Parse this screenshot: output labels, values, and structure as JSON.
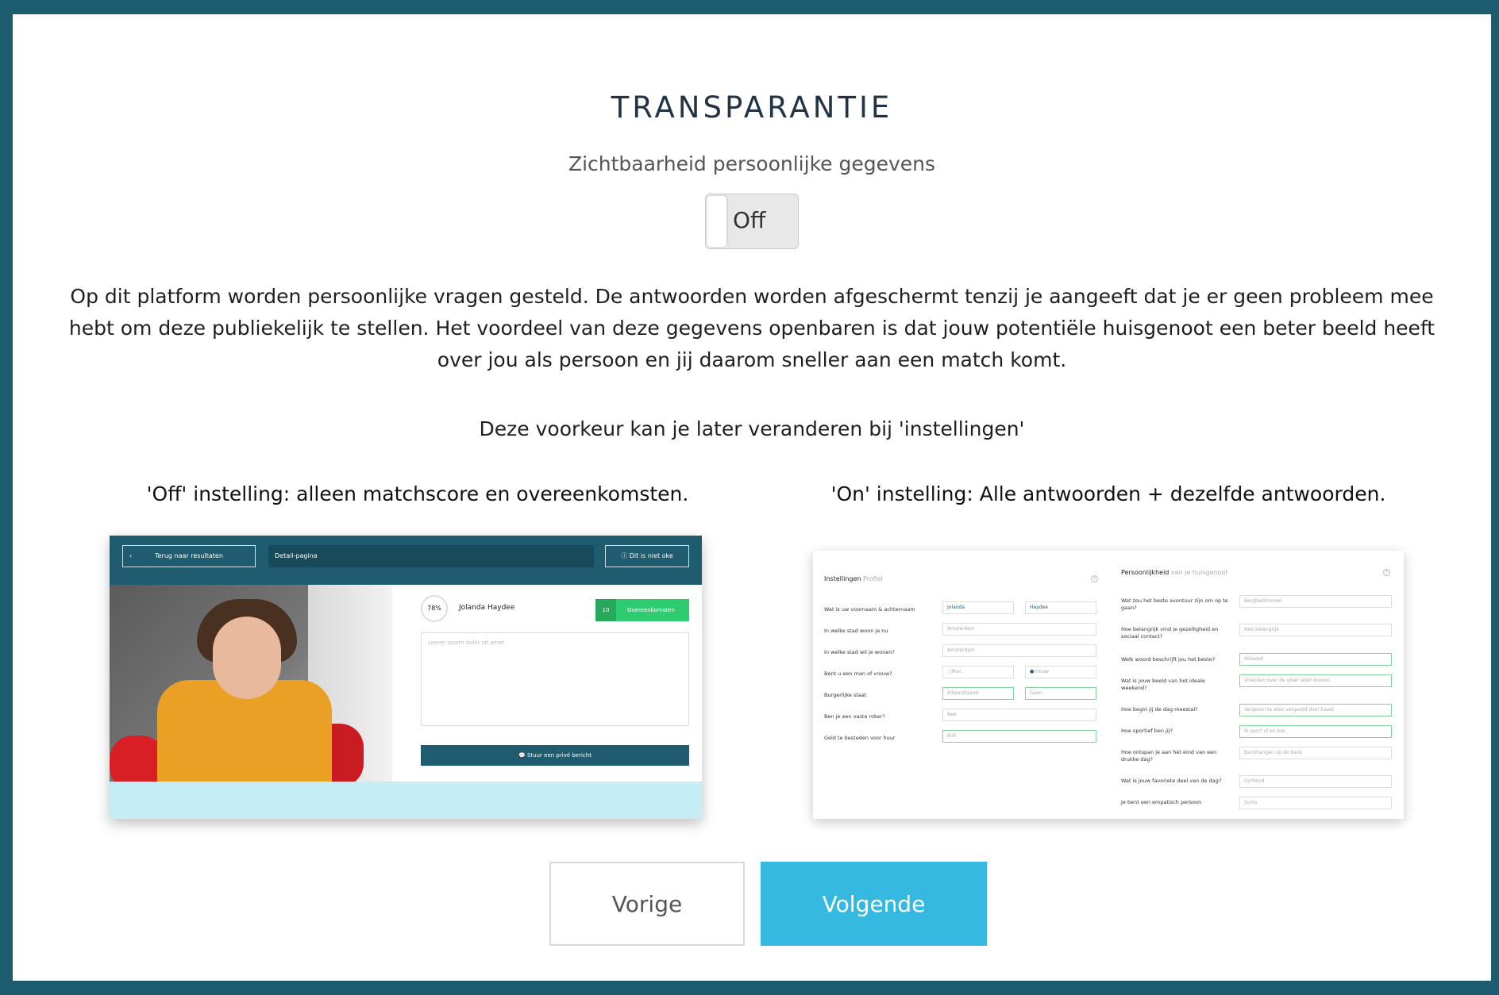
{
  "page": {
    "title": "TRANSPARANTIE",
    "subtitle": "Zichtbaarheid persoonlijke gegevens",
    "toggle_label": "Off",
    "paragraph": "Op dit platform worden persoonlijke vragen gesteld. De antwoorden worden afgeschermt tenzij je aangeeft dat je er geen probleem mee hebt om deze publiekelijk te stellen. Het voordeel van deze gegevens openbaren is dat jouw potentiële huisgenoot een beter beeld heeft over jou als persoon en jij daarom sneller aan een match komt.",
    "preference_note": "Deze voorkeur kan je later veranderen bij 'instellingen'",
    "caption_off": "'Off' instelling: alleen matchscore en overeenkomsten.",
    "caption_on": "'On' instelling: Alle antwoorden + dezelfde antwoorden."
  },
  "preview_off": {
    "back_button": "Terug naar resultaten",
    "page_label": "Detail-pagina",
    "dislike_button": "Dit is niet oke",
    "match_percent": "78%",
    "name": "Jolanda Haydee",
    "matches_count": "10",
    "matches_label": "Overeenkomsten",
    "message_placeholder": "Lorem ipsum dolor sit amet",
    "send_button": "Stuur een privé bericht"
  },
  "preview_on": {
    "left_heading": "Instellingen",
    "left_heading_sub": "Profiel",
    "right_heading": "Persoonlijkheid",
    "right_heading_sub": "van je huisgenoot",
    "left_questions": [
      "Wat is uw voornaam & achternaam",
      "In welke stad woon je nu",
      "In welke stad wil je wonen?",
      "Bent u een man of vrouw?",
      "Burgerlijke staat",
      "Ben je een vaste roker?",
      "Geld te besteden voor huur"
    ],
    "left_values": {
      "firstname": "Jolanda",
      "lastname": "Haydee",
      "city_now": "Amsterdam",
      "city_want": "Amsterdam",
      "gender_man": "Man",
      "gender_woman": "Vrouw",
      "civil_status": "Alleenstaand",
      "children": "Geen",
      "smoker": "Nee",
      "rent": "600"
    },
    "right_questions": [
      "Wat zou het beste avontuur zijn om op te gaan?",
      "Hoe belangrijk vind je gezelligheid en sociaal contact?",
      "Welk woord beschrijft jou het beste?",
      "Wat is jouw beeld van het ideale weekend?",
      "Hoe begin jij de dag meestal?",
      "Hoe sportief ben jij?",
      "Hoe ontspan je aan het eind van een drukke dag?",
      "Wat is jouw favoriete deel van de dag?",
      "Je bent een empatisch persoon"
    ],
    "right_values": [
      "Bergbeklimmen",
      "Niet belangrijk",
      "Relaxed",
      "Vrienden over de vloer laten komen",
      "Vergeten te eten vergeetd door haast",
      "Ik sport af en toe",
      "Bankhangen op de bank",
      "Ochtend",
      "Soms"
    ]
  },
  "nav": {
    "prev_label": "Vorige",
    "next_label": "Volgende"
  },
  "colors": {
    "frame": "#1d5b6e",
    "accent": "#36b9e0",
    "header": "#1f5c70",
    "match_green": "#2ecc71"
  }
}
